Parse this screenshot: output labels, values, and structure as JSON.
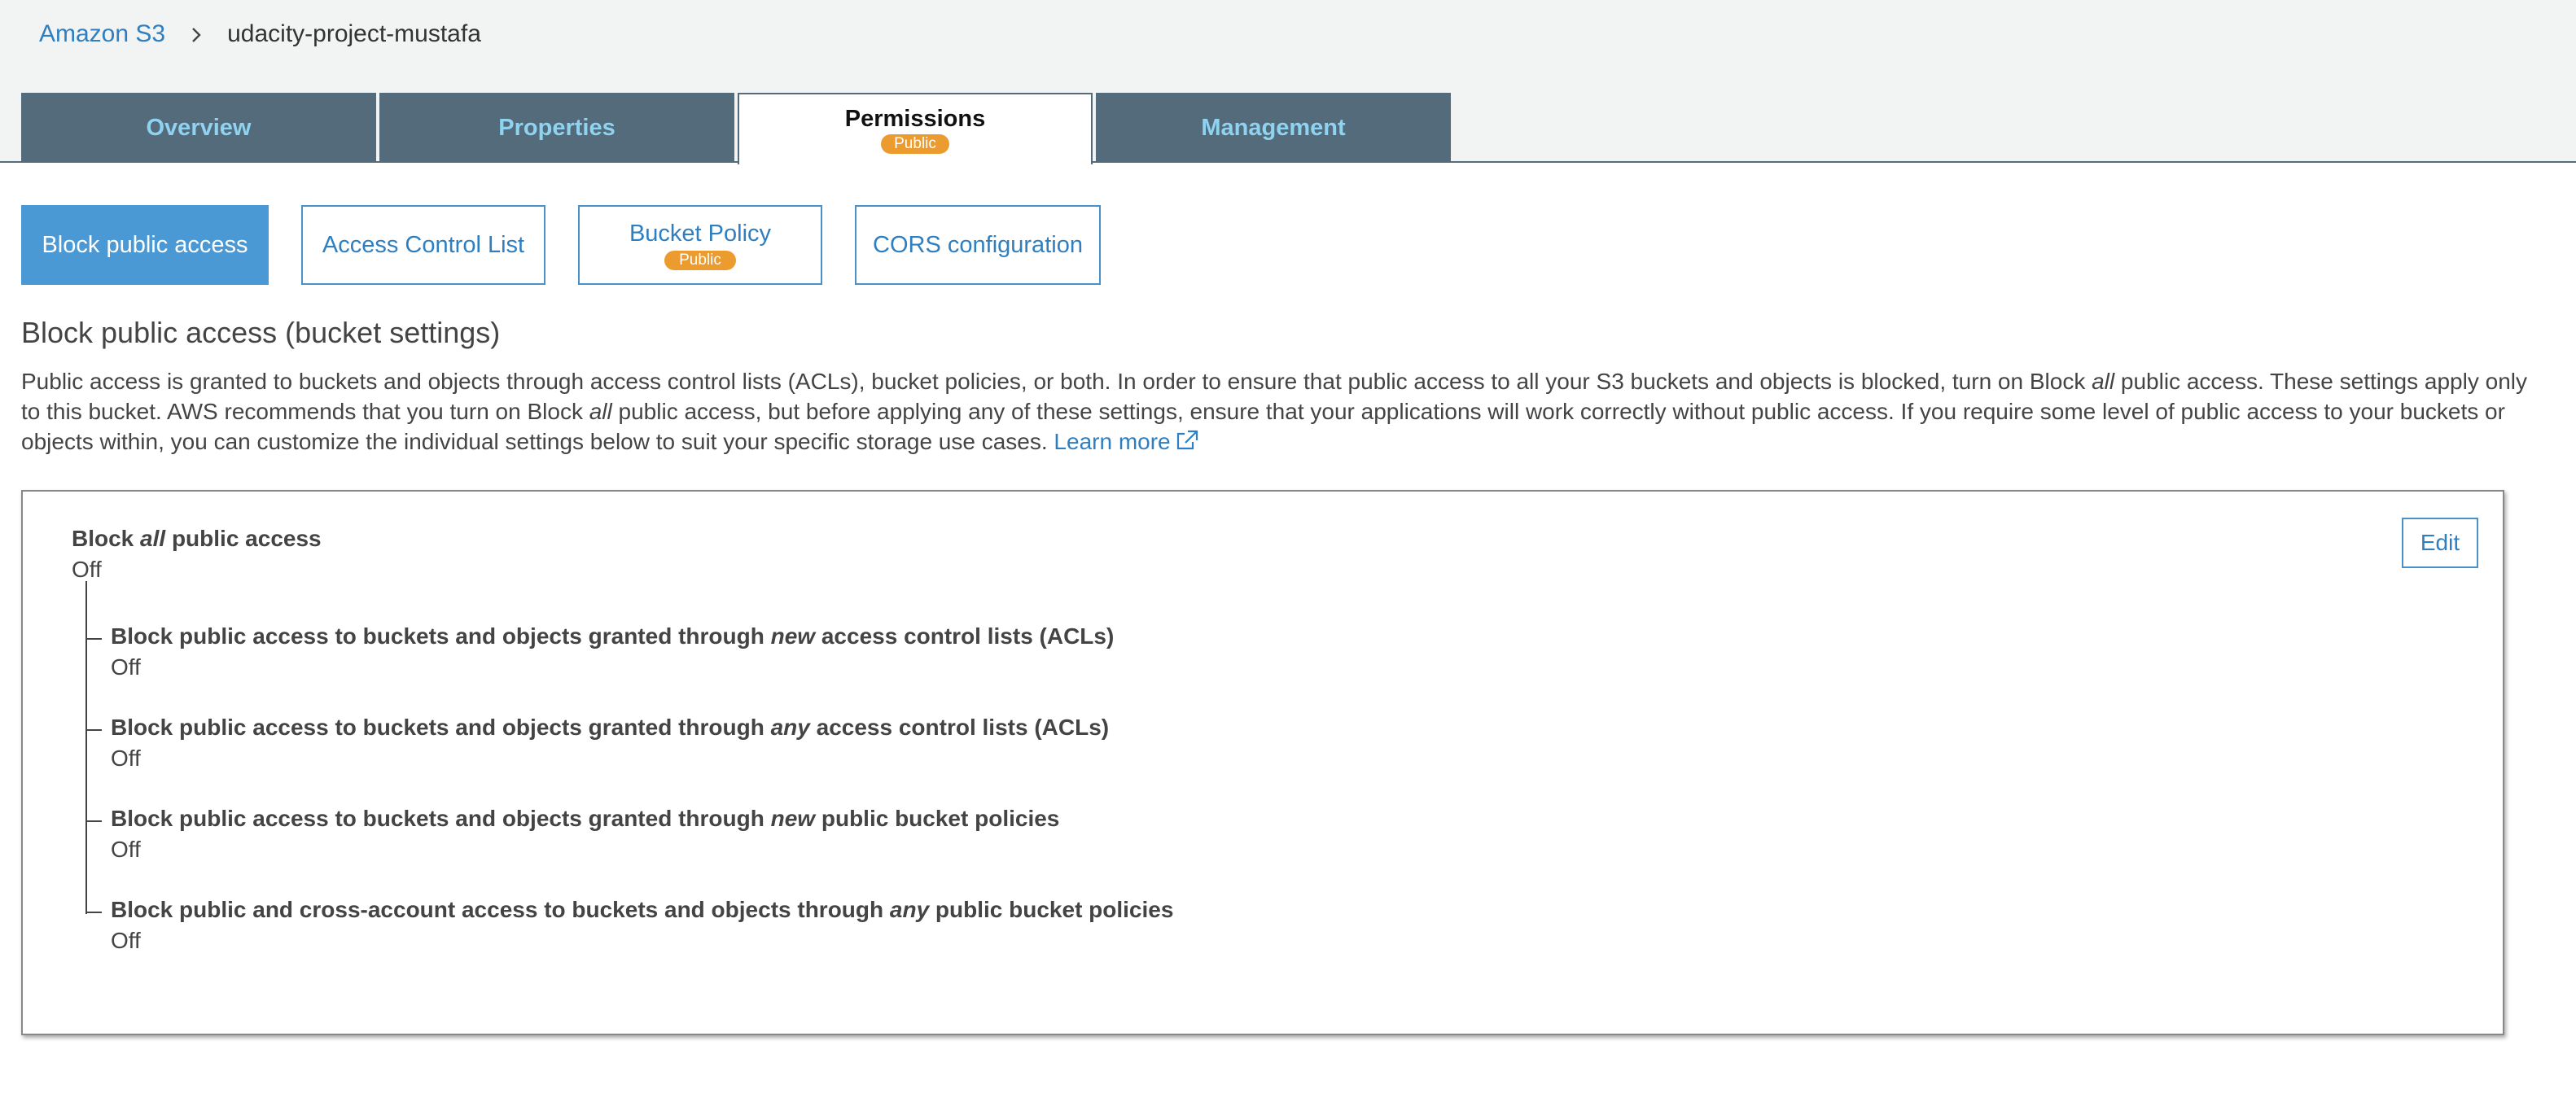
{
  "breadcrumb": {
    "root": "Amazon S3",
    "current": "udacity-project-mustafa"
  },
  "tabs": [
    {
      "label": "Overview"
    },
    {
      "label": "Properties"
    },
    {
      "label": "Permissions",
      "badge": "Public"
    },
    {
      "label": "Management"
    }
  ],
  "subtabs": [
    {
      "label": "Block public access"
    },
    {
      "label": "Access Control List"
    },
    {
      "label": "Bucket Policy",
      "badge": "Public"
    },
    {
      "label": "CORS configuration"
    }
  ],
  "section": {
    "title": "Block public access (bucket settings)",
    "description_part1": "Public access is granted to buckets and objects through access control lists (ACLs), bucket policies, or both. In order to ensure that public access to all your S3 buckets and objects is blocked, turn on Block ",
    "description_em1": "all",
    "description_part2": " public access. These settings apply only to this bucket. AWS recommends that you turn on Block ",
    "description_em2": "all",
    "description_part3": " public access, but before applying any of these settings, ensure that your applications will work correctly without public access. If you require some level of public access to your buckets or objects within, you can customize the individual settings below to suit your specific storage use cases. ",
    "learn_more": "Learn more"
  },
  "panel": {
    "edit_label": "Edit",
    "main": {
      "label_pre": "Block ",
      "label_em": "all",
      "label_post": " public access",
      "value": "Off"
    },
    "settings": [
      {
        "pre": "Block public access to buckets and objects granted through ",
        "em": "new",
        "post": " access control lists (ACLs)",
        "value": "Off"
      },
      {
        "pre": "Block public access to buckets and objects granted through ",
        "em": "any",
        "post": " access control lists (ACLs)",
        "value": "Off"
      },
      {
        "pre": "Block public access to buckets and objects granted through ",
        "em": "new",
        "post": " public bucket policies",
        "value": "Off"
      },
      {
        "pre": "Block public and cross-account access to buckets and objects through ",
        "em": "any",
        "post": " public bucket policies",
        "value": "Off"
      }
    ]
  },
  "colors": {
    "tab_background": "#546b7b",
    "tab_text": "#8fd3f0",
    "link": "#2f7fc0",
    "active_subtab": "#4a98d4",
    "badge": "#ec9b2f"
  },
  "icons": {
    "breadcrumb_separator": "chevron-right-icon",
    "learn_more": "external-link-icon"
  }
}
